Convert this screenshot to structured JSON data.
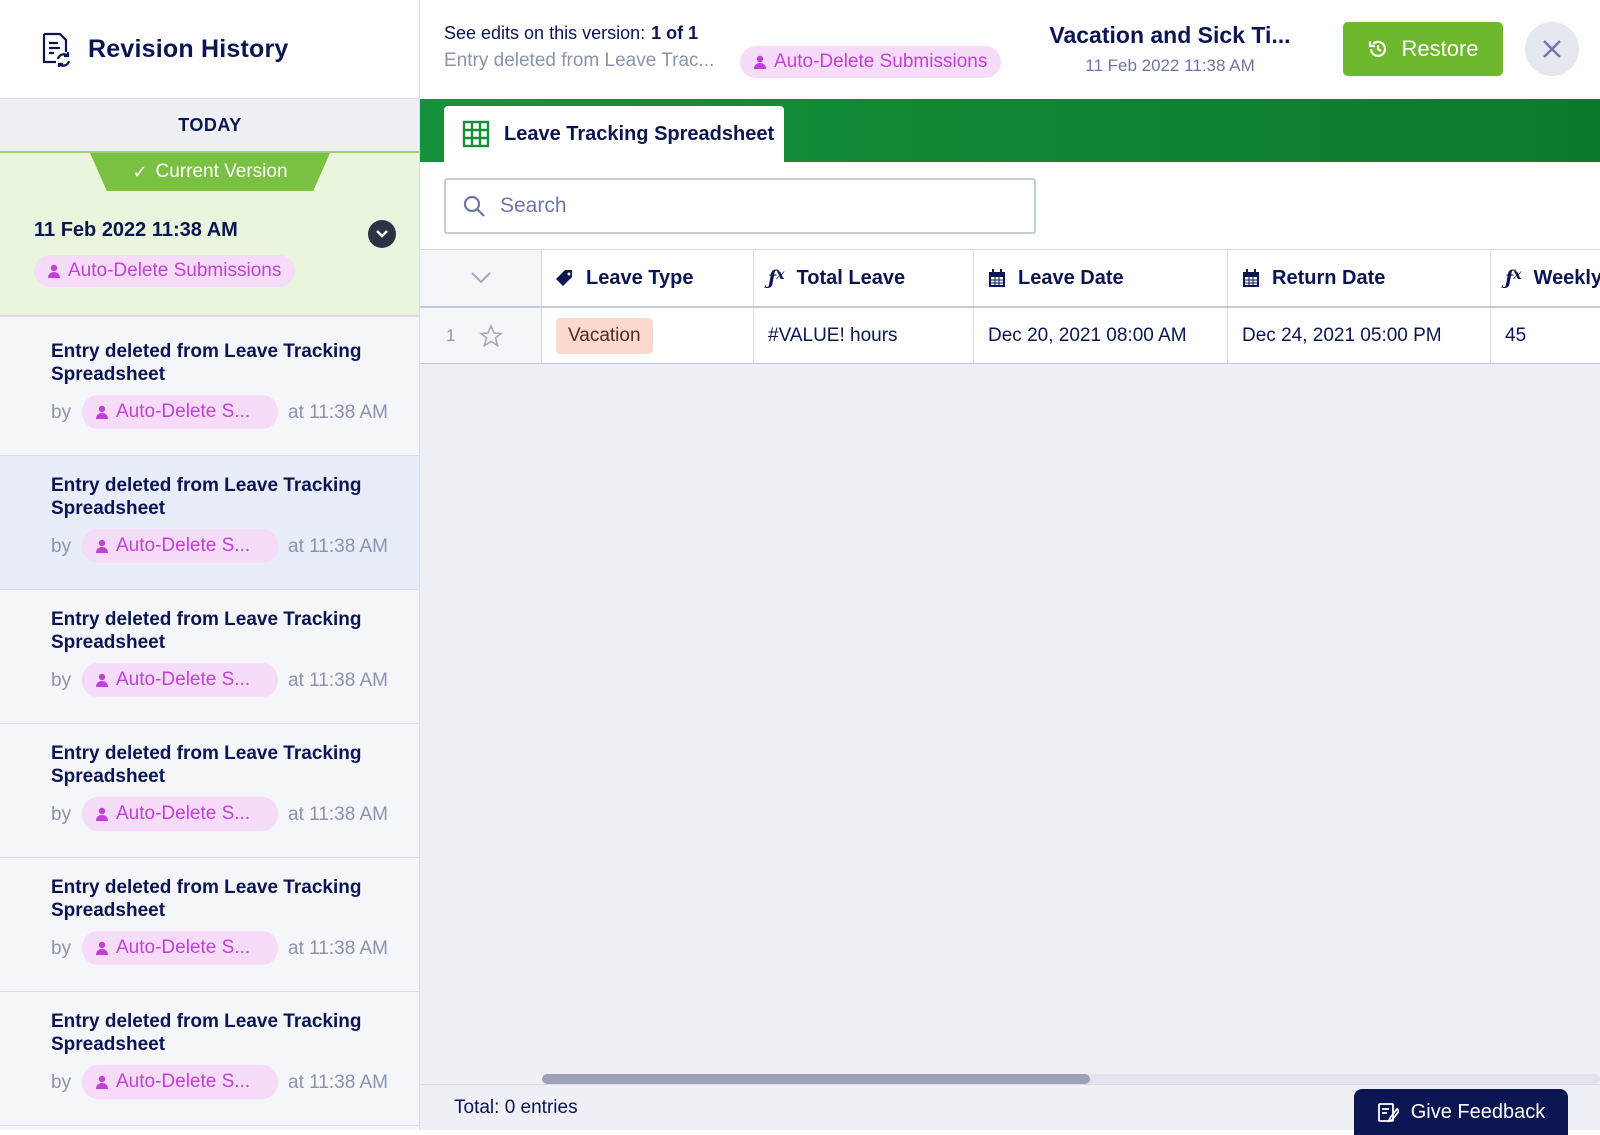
{
  "sidebar": {
    "title": "Revision History",
    "day_label": "TODAY",
    "current": {
      "badge": "Current Version",
      "date": "11 Feb 2022 11:38 AM",
      "user": "Auto-Delete Submissions"
    },
    "entries": [
      {
        "title": "Entry deleted from Leave Tracking Spreadsheet",
        "by": "by",
        "user": "Auto-Delete S...",
        "time": "at 11:38 AM"
      },
      {
        "title": "Entry deleted from Leave Tracking Spreadsheet",
        "by": "by",
        "user": "Auto-Delete S...",
        "time": "at 11:38 AM"
      },
      {
        "title": "Entry deleted from Leave Tracking Spreadsheet",
        "by": "by",
        "user": "Auto-Delete S...",
        "time": "at 11:38 AM"
      },
      {
        "title": "Entry deleted from Leave Tracking Spreadsheet",
        "by": "by",
        "user": "Auto-Delete S...",
        "time": "at 11:38 AM"
      },
      {
        "title": "Entry deleted from Leave Tracking Spreadsheet",
        "by": "by",
        "user": "Auto-Delete S...",
        "time": "at 11:38 AM"
      },
      {
        "title": "Entry deleted from Leave Tracking Spreadsheet",
        "by": "by",
        "user": "Auto-Delete S...",
        "time": "at 11:38 AM"
      }
    ]
  },
  "topbar": {
    "edits_label": "See edits on this version:",
    "edits_count": "1 of 1",
    "edit_summary": "Entry deleted from Leave Trac...",
    "edit_user": "Auto-Delete Submissions",
    "form_title": "Vacation and Sick Ti...",
    "form_date": "11 Feb 2022 11:38 AM",
    "restore_label": "Restore"
  },
  "sheet": {
    "tab_label": "Leave Tracking Spreadsheet",
    "search_placeholder": "Search",
    "columns": [
      {
        "label": "Leave Type",
        "icon": "tag-icon"
      },
      {
        "label": "Total Leave",
        "icon": "formula-icon"
      },
      {
        "label": "Leave Date",
        "icon": "calendar-icon"
      },
      {
        "label": "Return Date",
        "icon": "calendar-icon"
      },
      {
        "label": "Weekly",
        "icon": "formula-icon"
      }
    ],
    "rows": [
      {
        "num": "1",
        "leave_type": "Vacation",
        "total_leave": "#VALUE! hours",
        "leave_date": "Dec 20, 2021 08:00 AM",
        "return_date": "Dec 24, 2021 05:00 PM",
        "weekly": "45"
      }
    ],
    "total_label": "Total: 0 entries",
    "feedback_label": "Give Feedback"
  },
  "colors": {
    "accent_green": "#6db82c",
    "header_green": "#0b7a2c",
    "user_pill": "#c43fd9",
    "navy": "#0a1551"
  }
}
